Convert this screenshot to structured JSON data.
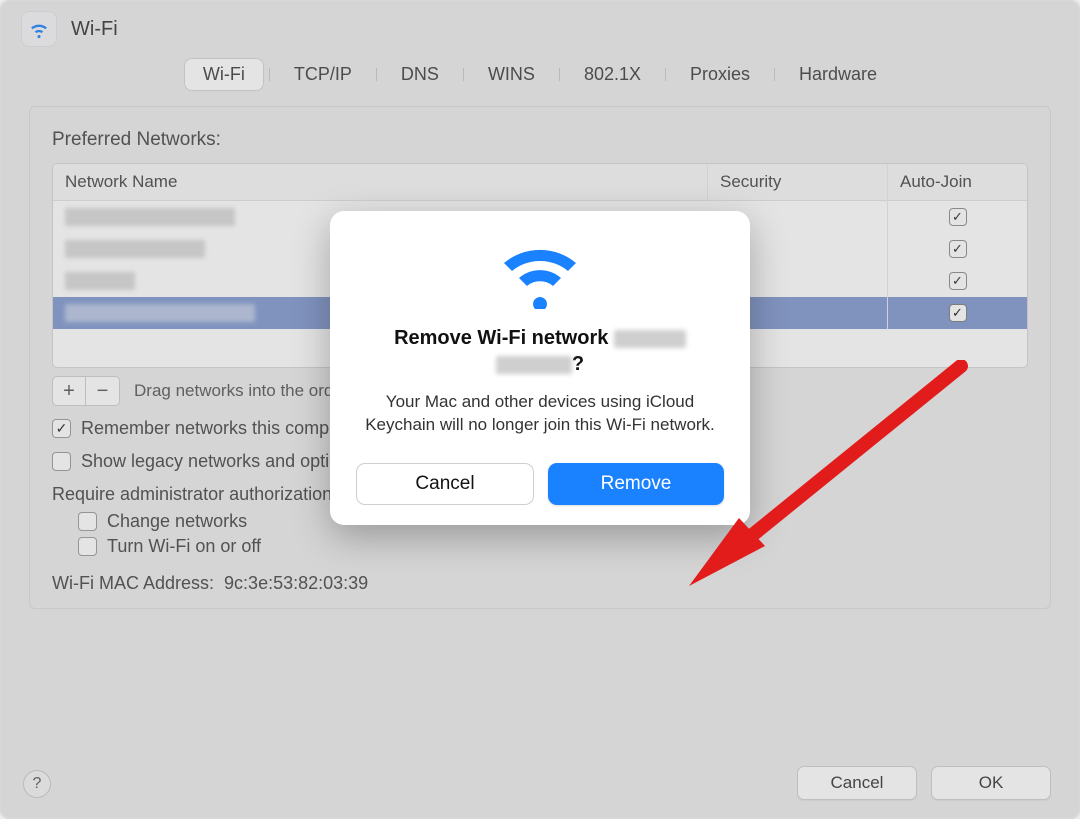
{
  "header": {
    "title": "Wi-Fi"
  },
  "tabs": {
    "items": [
      "Wi-Fi",
      "TCP/IP",
      "DNS",
      "WINS",
      "802.1X",
      "Proxies",
      "Hardware"
    ],
    "active_index": 0
  },
  "panel": {
    "preferred_label": "Preferred Networks:",
    "table": {
      "col_name": "Network Name",
      "col_security": "Security",
      "col_auto": "Auto-Join",
      "rows": [
        {
          "redacted": true,
          "auto_join": true,
          "selected": false
        },
        {
          "redacted": true,
          "auto_join": true,
          "selected": false
        },
        {
          "redacted": true,
          "auto_join": true,
          "selected": false
        },
        {
          "redacted": true,
          "auto_join": true,
          "selected": true
        }
      ]
    },
    "add_btn": "+",
    "remove_btn": "−",
    "drag_hint": "Drag networks into the order you prefer.",
    "remember_label": "Remember networks this computer has joined",
    "show_legacy_label": "Show legacy networks and options",
    "require_admin_label": "Require administrator authorization to:",
    "change_networks_label": "Change networks",
    "turn_wifi_label": "Turn Wi-Fi on or off",
    "mac_label": "Wi-Fi MAC Address:",
    "mac_value": "9c:3e:53:82:03:39",
    "remember_checked": true,
    "show_legacy_checked": false,
    "change_networks_checked": false,
    "turn_wifi_checked": false
  },
  "footer": {
    "help": "?",
    "cancel": "Cancel",
    "ok": "OK"
  },
  "modal": {
    "title_prefix": "Remove Wi-Fi network ",
    "title_suffix": "?",
    "body": "Your Mac and other devices using iCloud Keychain will no longer join this Wi-Fi network.",
    "cancel": "Cancel",
    "remove": "Remove"
  }
}
